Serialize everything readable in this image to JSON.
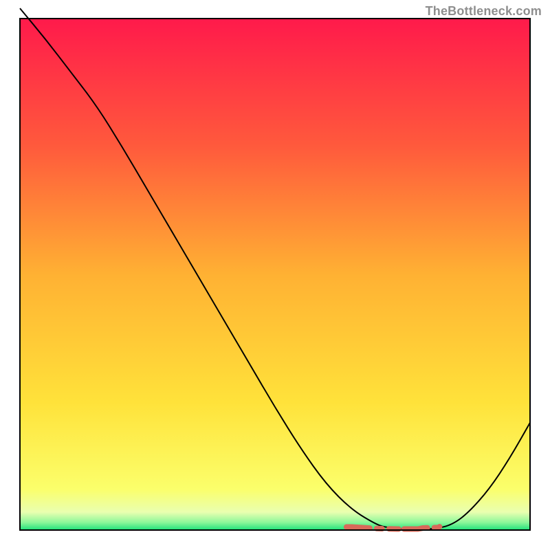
{
  "attribution": "TheBottleneck.com",
  "chart_data": {
    "type": "line",
    "title": "",
    "xlabel": "",
    "ylabel": "",
    "xlim": [
      0,
      100
    ],
    "ylim": [
      0,
      100
    ],
    "grid": false,
    "background": "heat-gradient",
    "gradient_stops": [
      {
        "pct": 0.0,
        "color": "#ff1a4b"
      },
      {
        "pct": 0.25,
        "color": "#ff5a3c"
      },
      {
        "pct": 0.5,
        "color": "#ffb133"
      },
      {
        "pct": 0.75,
        "color": "#ffe23a"
      },
      {
        "pct": 0.92,
        "color": "#fbff6b"
      },
      {
        "pct": 0.965,
        "color": "#e9ffb0"
      },
      {
        "pct": 0.985,
        "color": "#8cf79a"
      },
      {
        "pct": 1.0,
        "color": "#1de27a"
      }
    ],
    "series": [
      {
        "name": "bottleneck-curve",
        "color": "#000000",
        "x": [
          0,
          5,
          10,
          15,
          20,
          25,
          30,
          35,
          40,
          45,
          50,
          55,
          60,
          65,
          70,
          72,
          75,
          78,
          82,
          85,
          88,
          92,
          96,
          100
        ],
        "y": [
          102,
          96,
          89.5,
          83,
          75,
          66.5,
          58,
          49.5,
          41,
          32.5,
          24,
          16,
          9,
          4,
          1,
          0.5,
          0.2,
          0.1,
          0.3,
          1.2,
          3.5,
          8,
          14,
          21
        ]
      },
      {
        "name": "selection-marker",
        "color": "#d86a5a",
        "style": "thick-dashed",
        "x": [
          64,
          65,
          70,
          74,
          78,
          79,
          82,
          82.5
        ],
        "y": [
          0.6,
          0.6,
          0.3,
          0.2,
          0.2,
          0.4,
          0.5,
          0.8
        ]
      }
    ]
  }
}
